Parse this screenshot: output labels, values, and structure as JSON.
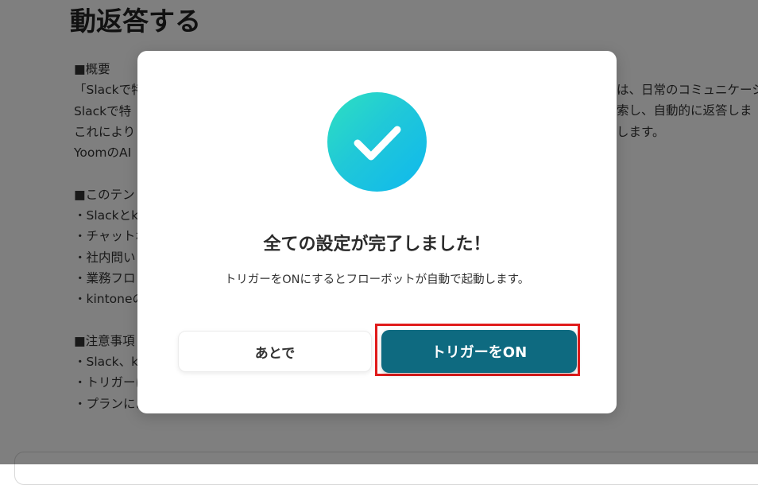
{
  "background": {
    "title": "動返答する",
    "body_lines": [
      "■概要",
      "「Slackで特",
      "Slackで特",
      "これにより",
      "YoomのAI",
      "",
      "■このテン",
      "・Slackとk",
      "・チャットボ",
      "・社内問い",
      "・業務フロ",
      "・kintoneの",
      "",
      "■注意事項",
      "・Slack、ki",
      "・トリガーは",
      "・プランによ"
    ],
    "right_fragments": [
      "は、日常のコミュニケーシ",
      "索し、自動的に返答しま",
      "します。"
    ]
  },
  "modal": {
    "icon": "checkmark-icon",
    "icon_colors": {
      "gradient_start": "#2ee0c0",
      "gradient_end": "#0fb8ee",
      "check": "#ffffff"
    },
    "title": "全ての設定が完了しました！",
    "description": "トリガーをONにするとフローボットが自動で起動します。",
    "later_button": "あとで",
    "on_button": "トリガーをON",
    "on_button_color": "#0e6a80",
    "highlight_color": "#e01b1b"
  }
}
